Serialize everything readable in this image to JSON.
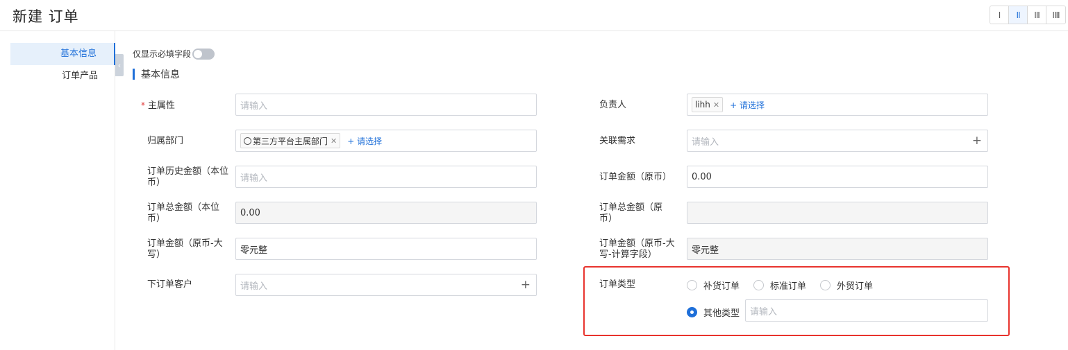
{
  "header": {
    "title": "新建 订单",
    "layout_options": [
      "I",
      "II",
      "III",
      "IIII"
    ],
    "active_layout": "II"
  },
  "sidenav": {
    "items": [
      {
        "label": "基本信息",
        "active": true
      },
      {
        "label": "订单产品",
        "active": false
      }
    ]
  },
  "toolbar": {
    "required_only_label": "仅显示必填字段",
    "required_only_on": false
  },
  "section": {
    "title": "基本信息"
  },
  "fields": {
    "main_attr": {
      "label": "主属性",
      "required": true,
      "placeholder": "请输入"
    },
    "owner": {
      "label": "负责人",
      "tag": "lihh",
      "select_label": "+ 请选择"
    },
    "dept": {
      "label": "归属部门",
      "tag": "第三方平台主属部门",
      "select_label": "+ 请选择"
    },
    "related_req": {
      "label": "关联需求",
      "placeholder": "请输入"
    },
    "hist_amount": {
      "label": "订单历史金额（本位币）",
      "placeholder": "请输入"
    },
    "amount_orig": {
      "label": "订单金额（原币）",
      "value": "0.00"
    },
    "total_base": {
      "label": "订单总金额（本位币）",
      "value": "0.00"
    },
    "total_orig": {
      "label": "订单总金额（原币）",
      "value": ""
    },
    "amount_upper": {
      "label": "订单金额（原币-大写）",
      "value": "零元整"
    },
    "amount_upper_calc": {
      "label": "订单金额（原币-大写-计算字段）",
      "value": "零元整"
    },
    "customer": {
      "label": "下订单客户",
      "placeholder": "请输入"
    },
    "order_type": {
      "label": "订单类型",
      "options": [
        "补货订单",
        "标准订单",
        "外贸订单"
      ],
      "other_label": "其他类型",
      "other_checked": true,
      "other_placeholder": "请输入"
    }
  },
  "colors": {
    "accent": "#1e6fd9",
    "highlight": "#e8332d",
    "required": "#e23b3b"
  }
}
